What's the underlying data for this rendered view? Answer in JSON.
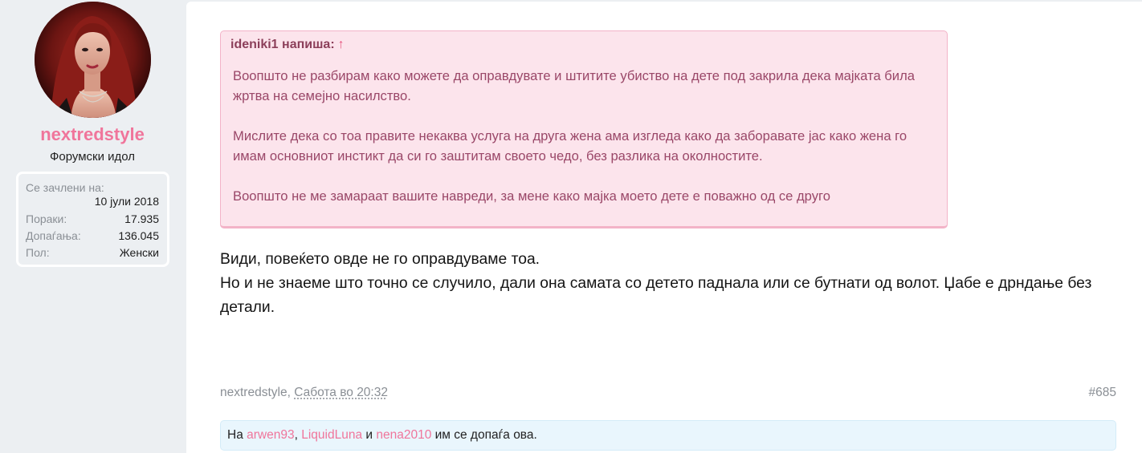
{
  "user": {
    "name": "nextredstyle",
    "title": "Форумски идол",
    "stats": {
      "joined_label": "Се зачлени на:",
      "joined_value": "10 јули 2018",
      "posts_label": "Пораки:",
      "posts_value": "17.935",
      "likes_label": "Допаѓања:",
      "likes_value": "136.045",
      "gender_label": "Пол:",
      "gender_value": "Женски"
    }
  },
  "quote": {
    "author": "ideniki1 напиша:",
    "arrow": "↑",
    "paragraphs": [
      "Воопшто не разбирам како можете да оправдувате и штитите убиство на дете под закрила дека мајката била жртва на семејно насилство.",
      "Мислите дека со тоа правите некаква услуга на друга жена ама изгледа како да заборавате јас како жена го имам основниот инстикт да си го заштитам своето чедо, без разлика на околностите.",
      "Воопшто не ме замараат вашите навреди, за мене како мајка моето дете е поважно од се друго"
    ]
  },
  "message": {
    "lines": [
      "Види, повеќето овде не го оправдуваме тоа.",
      "Но и не знаеме што точно се случило, дали она самата со детето паднала или се бутнати од волот. Џабе е дрндање без детали."
    ]
  },
  "meta": {
    "author": "nextredstyle",
    "separator": ", ",
    "date": "Сабота во 20:32",
    "post_number": "#685"
  },
  "likes": {
    "prefix": "На ",
    "users": [
      "arwen93",
      "LiquidLuna",
      "nena2010"
    ],
    "sep1": ", ",
    "sep2": " и ",
    "suffix": " им се допаѓа ова."
  },
  "colors": {
    "accent": "#f0759b",
    "quote_bg": "#fce4ec",
    "quote_text": "#9a4768",
    "likes_bg": "#e9f6fd"
  },
  "icons": {
    "avatar": "user-avatar-photo",
    "quote_jump": "arrow-up-icon"
  }
}
